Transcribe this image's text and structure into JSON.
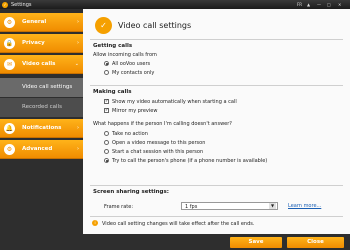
{
  "window": {
    "title": "Settings",
    "controls": [
      "FR",
      "▲",
      "—",
      "□",
      "✕"
    ]
  },
  "sidebar": {
    "items": [
      {
        "label": "General",
        "icon": "gear-icon",
        "glyph": "⚙"
      },
      {
        "label": "Privacy",
        "icon": "lock-icon",
        "glyph": "🔒"
      },
      {
        "label": "Video calls",
        "icon": "video-icon",
        "glyph": "✉"
      },
      {
        "label": "Notifications",
        "icon": "bell-icon",
        "glyph": "🔔"
      },
      {
        "label": "Advanced",
        "icon": "wrench-icon",
        "glyph": "⚙"
      }
    ],
    "subitems": [
      {
        "label": "Video call settings",
        "active": true
      },
      {
        "label": "Recorded calls",
        "active": false
      }
    ]
  },
  "content": {
    "title": "Video call settings",
    "getting_calls": {
      "heading": "Getting calls",
      "subtitle": "Allow incoming calls from",
      "options": [
        "All ooVoo users",
        "My contacts only"
      ],
      "selected": 0
    },
    "making_calls": {
      "heading": "Making calls",
      "options": [
        "Show my video automatically when starting a call",
        "Mirror my preview"
      ],
      "checked": [
        true,
        true
      ]
    },
    "no_answer": {
      "question": "What happens if the person I'm calling doesn't answer?",
      "options": [
        "Take no action",
        "Open a video message to this person",
        "Start a chat session with this person",
        "Try to call the person's phone (if a phone number is available)"
      ],
      "selected": 3
    },
    "screen_sharing": {
      "heading": "Screen sharing settings:",
      "frame_rate_label": "Frame rate:",
      "frame_rate_value": "1 fps",
      "learn_more": "Learn more..."
    },
    "info": "Video call setting changes will take effect after the call ends."
  },
  "footer": {
    "save": "Save",
    "close": "Close"
  },
  "colors": {
    "accent": "#f29100",
    "sidebar_bg": "#2e2e2e"
  }
}
